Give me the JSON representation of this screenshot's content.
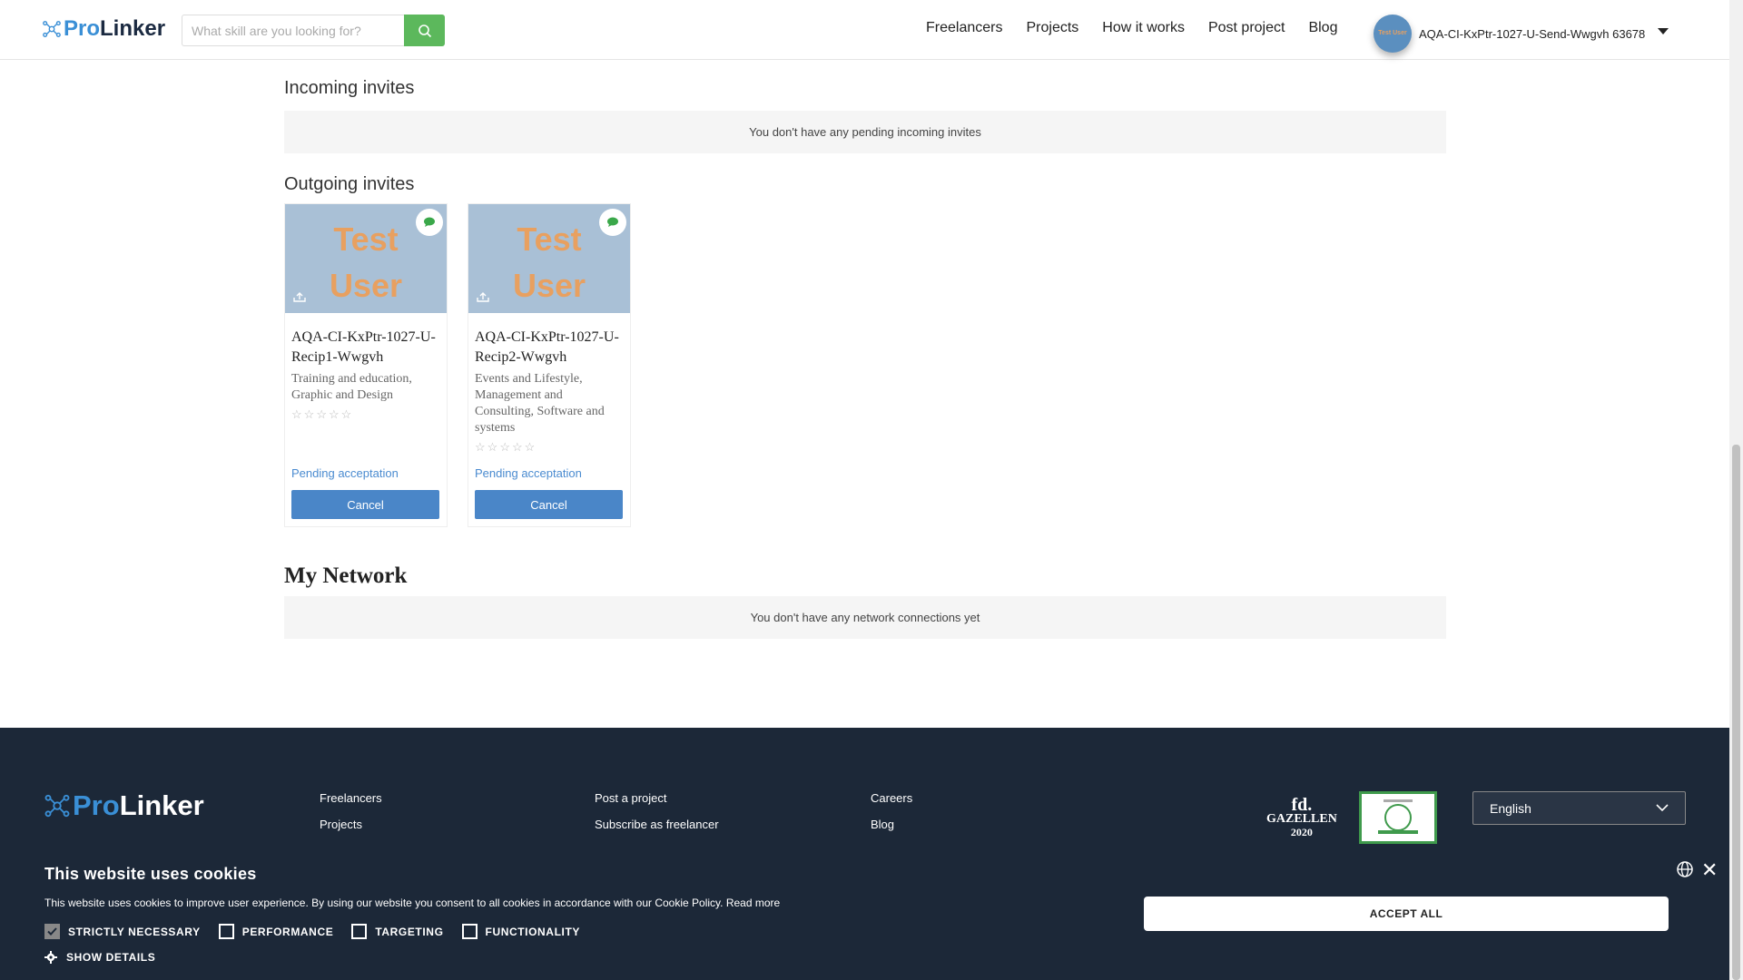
{
  "header": {
    "logo_pro": "Pro",
    "logo_linker": "Linker",
    "search_placeholder": "What skill are you looking for?",
    "nav": [
      "Freelancers",
      "Projects",
      "How it works",
      "Post project",
      "Blog"
    ],
    "user_name": "AQA-CI-KxPtr-1027-U-Send-Wwgvh 63678",
    "avatar_text": "Test User"
  },
  "incoming": {
    "title": "Incoming invites",
    "empty": "You don't have any pending incoming invites"
  },
  "outgoing": {
    "title": "Outgoing invites",
    "cards": [
      {
        "image_text_1": "Test",
        "image_text_2": "User",
        "name": "AQA-CI-KxPtr-1027-U-Recip1-Wwgvh",
        "categories": "Training and education, Graphic and Design",
        "rating": 0,
        "status": "Pending acceptation",
        "cancel_label": "Cancel"
      },
      {
        "image_text_1": "Test",
        "image_text_2": "User",
        "name": "AQA-CI-KxPtr-1027-U-Recip2-Wwgvh",
        "categories": "Events and Lifestyle, Management and Consulting, Software and systems",
        "rating": 0,
        "status": "Pending acceptation",
        "cancel_label": "Cancel"
      }
    ]
  },
  "network": {
    "title": "My Network",
    "empty": "You don't have any network connections yet"
  },
  "footer": {
    "col1": [
      "Freelancers",
      "Projects"
    ],
    "col2": [
      "Post a project",
      "Subscribe as freelancer"
    ],
    "col3": [
      "Careers",
      "Blog"
    ],
    "badge_fd": "fd.",
    "badge_gazellen": "GAZELLEN",
    "badge_year": "2020",
    "language": "English"
  },
  "cookie": {
    "title": "This website uses cookies",
    "text": "This website uses cookies to improve user experience. By using our website you consent to all cookies in accordance with our Cookie Policy.",
    "read_more": "Read more",
    "options": [
      {
        "label": "STRICTLY NECESSARY",
        "checked": true
      },
      {
        "label": "PERFORMANCE",
        "checked": false
      },
      {
        "label": "TARGETING",
        "checked": false
      },
      {
        "label": "FUNCTIONALITY",
        "checked": false
      }
    ],
    "show_details": "SHOW DETAILS",
    "accept_label": "ACCEPT ALL"
  },
  "colors": {
    "brand_blue": "#3a8fd6",
    "search_green": "#5cb85c",
    "cancel_button": "#4a86c8",
    "footer_bg": "#1c2838"
  }
}
